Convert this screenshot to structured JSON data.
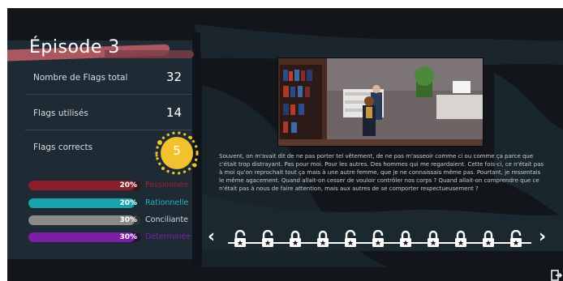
{
  "episode": {
    "title": "Épisode 3"
  },
  "stats": [
    {
      "label": "Nombre de Flags total",
      "value": "32"
    },
    {
      "label": "Flags utilisés",
      "value": "14"
    },
    {
      "label": "Flags corrects",
      "value": "5"
    }
  ],
  "profile_bars": [
    {
      "percent_label": "20%",
      "fraction": 0.95,
      "name": "Passionnée",
      "track": "#3a1418",
      "fill": "#8a1e2b",
      "name_color": "#a3212f"
    },
    {
      "percent_label": "20%",
      "fraction": 0.95,
      "name": "Rationnelle",
      "track": "#0f3237",
      "fill": "#1aa3ad",
      "name_color": "#2ab3be"
    },
    {
      "percent_label": "30%",
      "fraction": 0.95,
      "name": "Conciliante",
      "track": "#333333",
      "fill": "#8a8a8a",
      "name_color": "#d8d8d8"
    },
    {
      "percent_label": "30%",
      "fraction": 0.95,
      "name": "Déterminée",
      "track": "#2a0f3a",
      "fill": "#7d1ea8",
      "name_color": "#7a1fae"
    }
  ],
  "story": {
    "text": "Souvent, on m'avait dit de ne pas porter tel vêtement, de ne pas m'asseoir comme ci ou comme ça parce que c'était trop distrayant. Pas pour moi. Pour les autres. Des hommes qui me regardaient. Cette fois-ci, ce n'était pas à moi qu'on reprochait tout ça mais à une autre femme, que je ne connaissais même pas. Pourtant, je ressentais le même agacement. Quand allait-on cesser de vouloir contrôler nos corps ? Quand allait-on comprendre que ce n'était pas à nous de faire attention, mais aux autres de se comporter respectueusement ?"
  },
  "navigation": {
    "prev": "‹",
    "next": "›"
  },
  "locks": [
    {
      "state": "open"
    },
    {
      "state": "open"
    },
    {
      "state": "closed"
    },
    {
      "state": "closed"
    },
    {
      "state": "open"
    },
    {
      "state": "open"
    },
    {
      "state": "closed"
    },
    {
      "state": "closed"
    },
    {
      "state": "closed"
    },
    {
      "state": "closed"
    },
    {
      "state": "open"
    }
  ],
  "icons": {
    "exit": "exit-icon",
    "lock_open": "lock-open-icon",
    "lock_closed": "lock-closed-icon",
    "splash": "score-splash-icon"
  },
  "colors": {
    "background": "#12161b",
    "panel": "#1e2b34",
    "splash": "#f2c12e",
    "brush": "#b35a63"
  }
}
